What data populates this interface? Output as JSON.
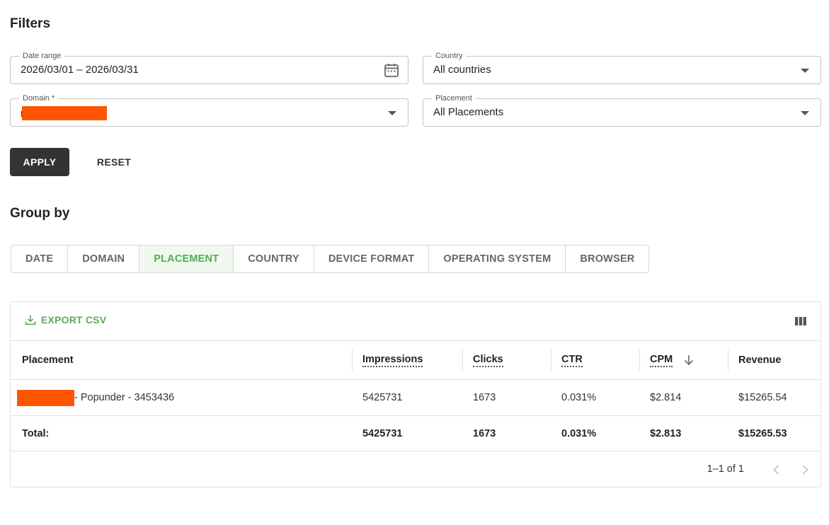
{
  "filters": {
    "title": "Filters",
    "date_range": {
      "label": "Date range",
      "value": "2026/03/01 – 2026/03/31"
    },
    "country": {
      "label": "Country",
      "value": "All countries"
    },
    "domain": {
      "label": "Domain *",
      "value_prefix": "ti"
    },
    "placement": {
      "label": "Placement",
      "value": "All Placements"
    },
    "apply_label": "APPLY",
    "reset_label": "RESET"
  },
  "group_by": {
    "title": "Group by",
    "tabs": [
      "DATE",
      "DOMAIN",
      "PLACEMENT",
      "COUNTRY",
      "DEVICE FORMAT",
      "OPERATING SYSTEM",
      "BROWSER"
    ],
    "active": "PLACEMENT"
  },
  "grid": {
    "export_label": "EXPORT CSV",
    "columns": [
      "Placement",
      "Impressions",
      "Clicks",
      "CTR",
      "CPM",
      "Revenue"
    ],
    "sort_column": "CPM",
    "sort_direction": "desc",
    "rows": [
      {
        "placement_suffix": "- Popunder - 3453436",
        "impressions": "5425731",
        "clicks": "1673",
        "ctr": "0.031%",
        "cpm": "$2.814",
        "revenue": "$15265.54"
      }
    ],
    "total": {
      "label": "Total:",
      "impressions": "5425731",
      "clicks": "1673",
      "ctr": "0.031%",
      "cpm": "$2.813",
      "revenue": "$15265.53"
    },
    "pagination": "1–1 of 1"
  },
  "colors": {
    "accent_green": "#4caf50",
    "redaction": "#ff5500",
    "apply_button": "#333333"
  }
}
